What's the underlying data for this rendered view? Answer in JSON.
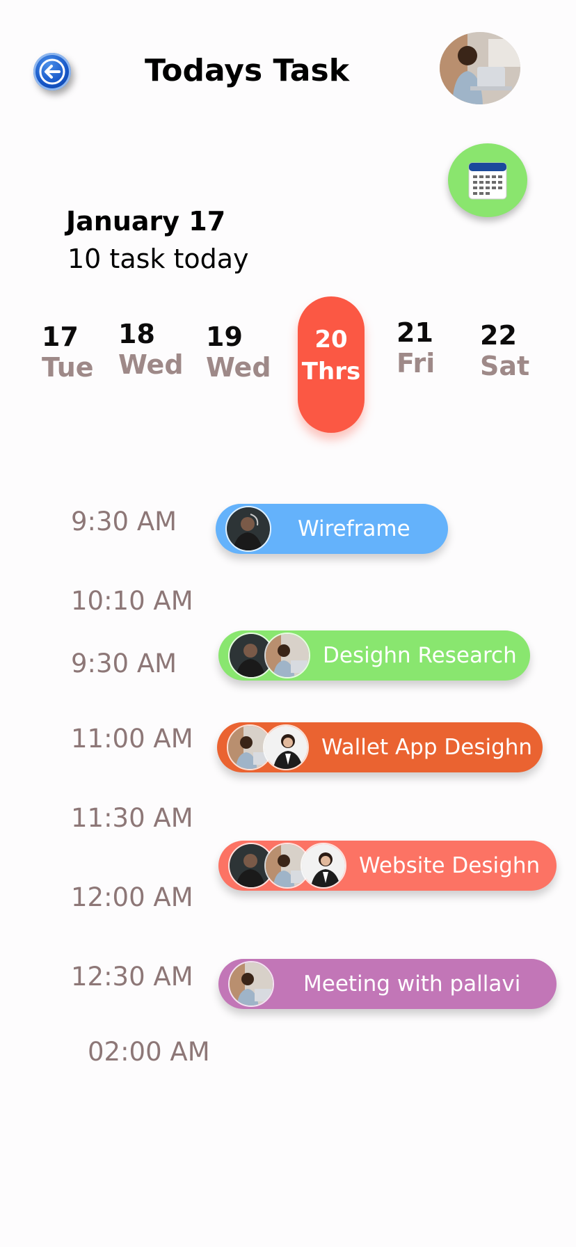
{
  "header": {
    "title": "Todays Task",
    "back_icon": "arrow-left-icon",
    "avatar": "user-avatar",
    "calendar_icon": "calendar-icon"
  },
  "summary": {
    "date": "January 17",
    "task_count": "10 task today"
  },
  "days": [
    {
      "num": "17",
      "name": "Tue"
    },
    {
      "num": "18",
      "name": "Wed"
    },
    {
      "num": "19",
      "name": "Wed"
    },
    {
      "num": "20",
      "name": "Thrs",
      "selected": true
    },
    {
      "num": "21",
      "name": "Fri"
    },
    {
      "num": "22",
      "name": "Sat"
    }
  ],
  "times": [
    "9:30 AM",
    "10:10 AM",
    "9:30 AM",
    "11:00 AM",
    "11:30 AM",
    "12:00 AM",
    "12:30 AM",
    "02:00 AM"
  ],
  "tasks": [
    {
      "label": "Wireframe",
      "color": "#64b2fb"
    },
    {
      "label": "Desighn Research",
      "color": "#89e66f"
    },
    {
      "label": "Wallet App Desighn",
      "color": "#ea6331"
    },
    {
      "label": "Website Desighn",
      "color": "#fc7364"
    },
    {
      "label": "Meeting with pallavi",
      "color": "#c276b7"
    }
  ],
  "colors": {
    "accent": "#fb5844",
    "time_text": "#8d7777",
    "day_name": "#9e8988"
  }
}
